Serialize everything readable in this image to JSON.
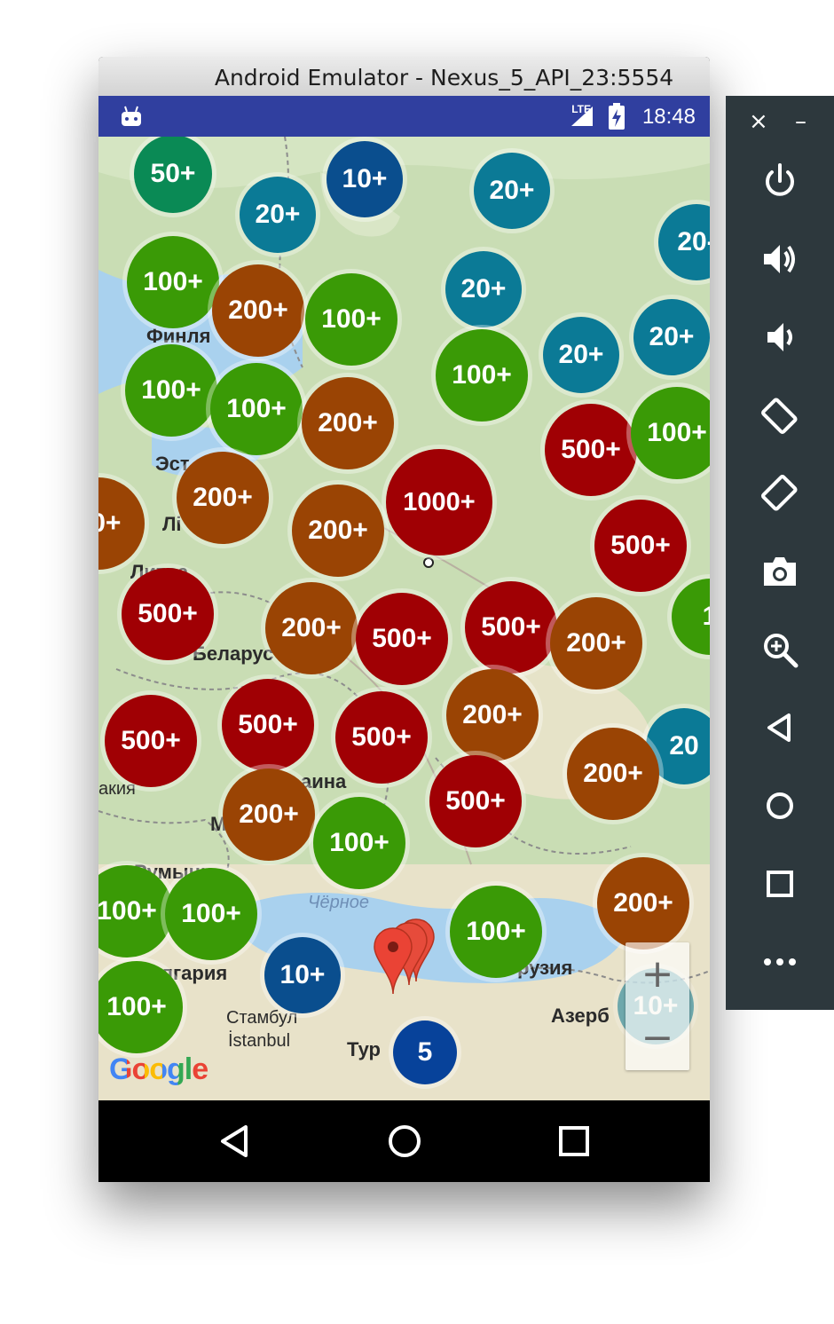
{
  "window": {
    "title": "Android Emulator - Nexus_5_API_23:5554"
  },
  "status_bar": {
    "time": "18:48",
    "network": "LTE",
    "background": "#303f9f"
  },
  "map": {
    "labels": [
      {
        "text": "Финля"
      },
      {
        "text": "Эст"
      },
      {
        "text": "Лі"
      },
      {
        "text": "Литва"
      },
      {
        "text": "Беларус"
      },
      {
        "text": "М"
      },
      {
        "text": "аина"
      },
      {
        "text": "акия"
      },
      {
        "text": "Румыни"
      },
      {
        "text": "Чёрное"
      },
      {
        "text": "лгария"
      },
      {
        "text": "Стамбул"
      },
      {
        "text": "İstanbul"
      },
      {
        "text": "Тур"
      },
      {
        "text": "рузия"
      },
      {
        "text": "Азерб"
      }
    ],
    "clusters": [
      {
        "label": "50+",
        "color": "green50"
      },
      {
        "label": "10+",
        "color": "blue"
      },
      {
        "label": "20+",
        "color": "teal"
      },
      {
        "label": "20+",
        "color": "teal"
      },
      {
        "label": "20-",
        "color": "teal"
      },
      {
        "label": "100+",
        "color": "green"
      },
      {
        "label": "200+",
        "color": "brown"
      },
      {
        "label": "100+",
        "color": "green"
      },
      {
        "label": "20+",
        "color": "teal"
      },
      {
        "label": "20+",
        "color": "teal"
      },
      {
        "label": "20+",
        "color": "teal"
      },
      {
        "label": "100+",
        "color": "green"
      },
      {
        "label": "100+",
        "color": "green"
      },
      {
        "label": "100+",
        "color": "green"
      },
      {
        "label": "200+",
        "color": "brown"
      },
      {
        "label": "500+",
        "color": "red"
      },
      {
        "label": "100+",
        "color": "green"
      },
      {
        "label": "00+",
        "color": "brown"
      },
      {
        "label": "200+",
        "color": "brown"
      },
      {
        "label": "200+",
        "color": "brown"
      },
      {
        "label": "1000+",
        "color": "red"
      },
      {
        "label": "500+",
        "color": "red"
      },
      {
        "label": "1",
        "color": "green"
      },
      {
        "label": "500+",
        "color": "red"
      },
      {
        "label": "200+",
        "color": "brown"
      },
      {
        "label": "500+",
        "color": "red"
      },
      {
        "label": "500+",
        "color": "red"
      },
      {
        "label": "200+",
        "color": "brown"
      },
      {
        "label": "500+",
        "color": "red"
      },
      {
        "label": "500+",
        "color": "red"
      },
      {
        "label": "500+",
        "color": "red"
      },
      {
        "label": "200+",
        "color": "brown"
      },
      {
        "label": "20",
        "color": "teal"
      },
      {
        "label": "200+",
        "color": "brown"
      },
      {
        "label": "200+",
        "color": "brown"
      },
      {
        "label": "500+",
        "color": "red"
      },
      {
        "label": "100+",
        "color": "green"
      },
      {
        "label": "200+",
        "color": "brown"
      },
      {
        "label": "100+",
        "color": "green"
      },
      {
        "label": "100+",
        "color": "green"
      },
      {
        "label": "100+",
        "color": "green"
      },
      {
        "label": "10+",
        "color": "blue"
      },
      {
        "label": "100+",
        "color": "green"
      },
      {
        "label": "10+",
        "color": "teal"
      },
      {
        "label": "5",
        "color": "darkblue"
      }
    ],
    "zoom_in_label": "+",
    "zoom_out_label": "−",
    "attribution": "Google"
  },
  "side_panel": {
    "close_label": "×",
    "minimize_label": "–",
    "buttons": [
      "power",
      "volume-up",
      "volume-down",
      "rotate-left",
      "rotate-right",
      "screenshot",
      "zoom",
      "back",
      "home",
      "overview",
      "more"
    ]
  }
}
